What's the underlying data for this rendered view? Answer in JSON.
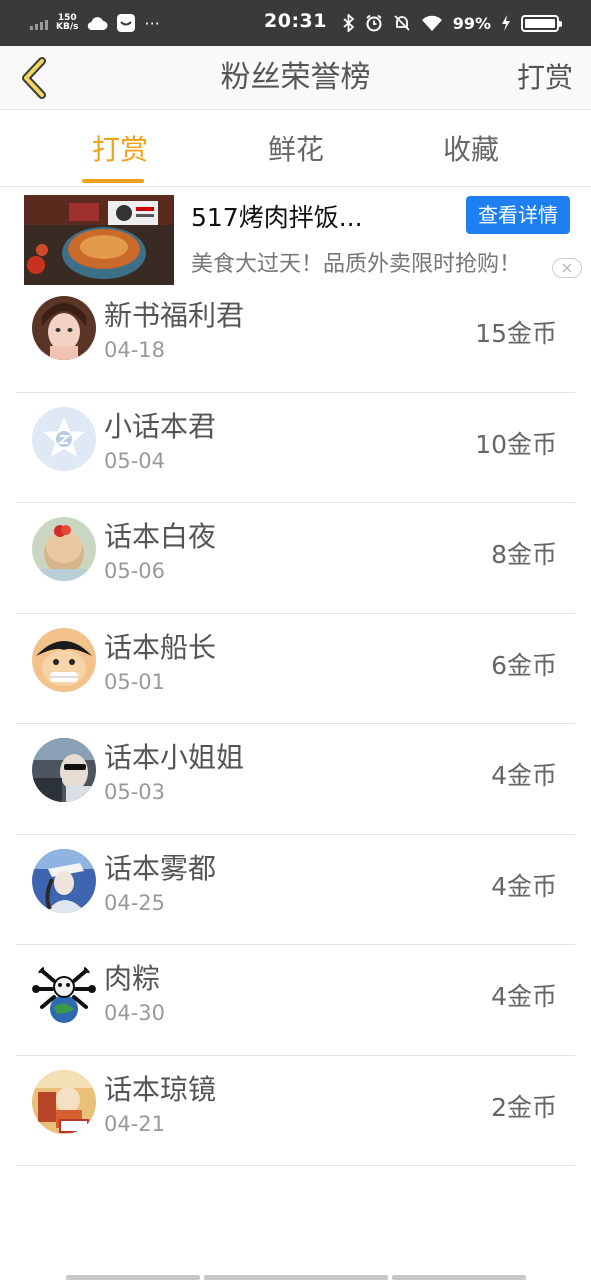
{
  "status_bar": {
    "net_speed_value": "150",
    "net_speed_unit": "KB/s",
    "time": "20:31",
    "battery": "99%",
    "more": "···"
  },
  "nav": {
    "title": "粉丝荣誉榜",
    "action": "打赏"
  },
  "tabs": [
    {
      "label": "打赏",
      "active": true
    },
    {
      "label": "鲜花",
      "active": false
    },
    {
      "label": "收藏",
      "active": false
    }
  ],
  "ad": {
    "title": "517烤肉拌饭...",
    "button": "查看详情",
    "description": "美食大过天！品质外卖限时抢购！"
  },
  "fans": [
    {
      "name": "新书福利君",
      "date": "04-18",
      "amount": "15金币"
    },
    {
      "name": "小话本君",
      "date": "05-04",
      "amount": "10金币"
    },
    {
      "name": "话本白夜",
      "date": "05-06",
      "amount": "8金币"
    },
    {
      "name": "话本船长",
      "date": "05-01",
      "amount": "6金币"
    },
    {
      "name": "话本小姐姐",
      "date": "05-03",
      "amount": "4金币"
    },
    {
      "name": "话本雾都",
      "date": "04-25",
      "amount": "4金币"
    },
    {
      "name": "肉粽",
      "date": "04-30",
      "amount": "4金币"
    },
    {
      "name": "话本琼镜",
      "date": "04-21",
      "amount": "2金币"
    }
  ],
  "colors": {
    "accent": "#f0a019",
    "ad_button": "#1d7ff0",
    "status_bar": "#3a3a3a"
  }
}
